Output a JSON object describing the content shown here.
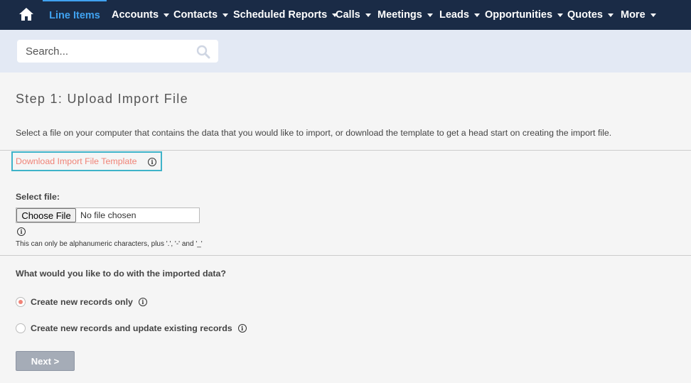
{
  "nav": {
    "home_icon": "home-icon",
    "items": [
      {
        "label": "Line Items",
        "active": true,
        "dropdown": false
      },
      {
        "label": "Accounts",
        "dropdown": true
      },
      {
        "label": "Contacts",
        "dropdown": true
      },
      {
        "label": "Scheduled Reports",
        "dropdown": true
      },
      {
        "label": "Calls",
        "dropdown": true
      },
      {
        "label": "Meetings",
        "dropdown": true
      },
      {
        "label": "Leads",
        "dropdown": true
      },
      {
        "label": "Opportunities",
        "dropdown": true
      },
      {
        "label": "Quotes",
        "dropdown": true
      },
      {
        "label": "More",
        "dropdown": true
      }
    ]
  },
  "search": {
    "placeholder": "Search...",
    "icon": "search-icon"
  },
  "step": {
    "title": "Step 1: Upload Import File",
    "description": "Select a file on your computer that contains the data that you would like to import, or download the template to get a head start on creating the import file.",
    "download_link": "Download Import File Template"
  },
  "file": {
    "label": "Select file:",
    "button": "Choose File",
    "status": "No file chosen",
    "hint": "This can only be alphanumeric characters, plus '.', '-' and '_'"
  },
  "import_action": {
    "question": "What would you like to do with the imported data?",
    "options": [
      {
        "label": "Create new records only",
        "selected": true
      },
      {
        "label": "Create new records and update existing records",
        "selected": false
      }
    ]
  },
  "next_button": "Next >",
  "colors": {
    "nav_bg": "#1a2b46",
    "active": "#40a2f0",
    "link": "#f08377",
    "highlight": "#3fb3c9"
  }
}
